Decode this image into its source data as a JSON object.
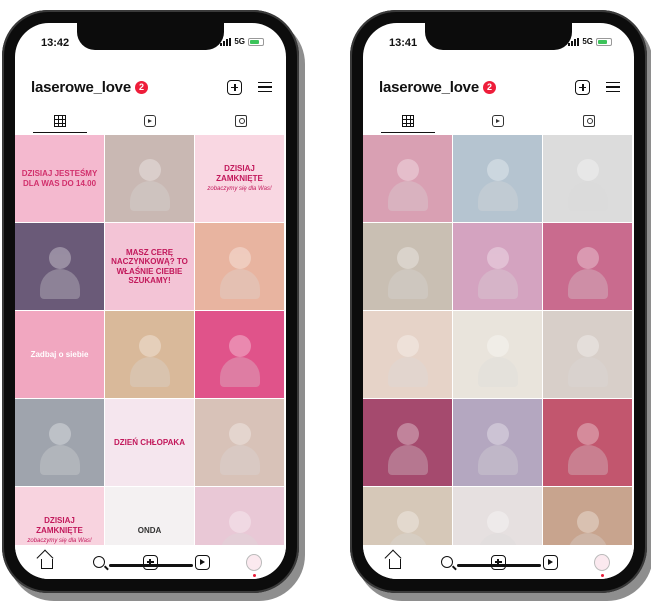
{
  "left_phone": {
    "time": "13:42",
    "network": "5G",
    "username": "laserowe_love",
    "badge": "2",
    "posts": [
      {
        "text": "DZISIAJ JESTEŚMY DLA WAS DO 14.00",
        "sub": "",
        "bg": "#f4b9cf",
        "fg": "#d1306c"
      },
      {
        "text": "",
        "sub": "",
        "bg": "#c9b8b3",
        "fg": "#ffffff"
      },
      {
        "text": "DZISIAJ ZAMKNIĘTE",
        "sub": "zobaczymy się dla Was!",
        "bg": "#f9d7e2",
        "fg": "#c2185b"
      },
      {
        "text": "",
        "sub": "",
        "bg": "#6a5a78",
        "fg": "#ffffff"
      },
      {
        "text": "MASZ CERĘ NACZYNKOWĄ? TO WŁAŚNIE CIEBIE SZUKAMY!",
        "sub": "",
        "bg": "#f3c4d6",
        "fg": "#c2185b"
      },
      {
        "text": "",
        "sub": "",
        "bg": "#e8b4a0",
        "fg": "#ffffff"
      },
      {
        "text": "Zadbaj o siebie",
        "sub": "",
        "bg": "#f1a7c0",
        "fg": "#ffffff"
      },
      {
        "text": "",
        "sub": "",
        "bg": "#d9b99a",
        "fg": "#ffffff"
      },
      {
        "text": "",
        "sub": "",
        "bg": "#e0538a",
        "fg": "#ffffff"
      },
      {
        "text": "",
        "sub": "",
        "bg": "#9fa4ad",
        "fg": "#ffffff"
      },
      {
        "text": "DZIEŃ CHŁOPAKA",
        "sub": "",
        "bg": "#f5e6ee",
        "fg": "#c2185b"
      },
      {
        "text": "",
        "sub": "",
        "bg": "#d8c2b8",
        "fg": "#ffffff"
      },
      {
        "text": "DZISIAJ ZAMKNIĘTE",
        "sub": "zobaczymy się dla Was!",
        "bg": "#f8d3df",
        "fg": "#c2185b"
      },
      {
        "text": "ONDA",
        "sub": "",
        "bg": "#f4f1f2",
        "fg": "#333333"
      },
      {
        "text": "",
        "sub": "",
        "bg": "#e9c8d6",
        "fg": "#ffffff"
      }
    ]
  },
  "right_phone": {
    "time": "13:41",
    "network": "5G",
    "username": "laserowe_love",
    "badge": "2",
    "posts": [
      {
        "text": "",
        "sub": "",
        "bg": "#d9a0b3",
        "fg": "#ffffff"
      },
      {
        "text": "",
        "sub": "",
        "bg": "#b5c4d0",
        "fg": "#ffffff"
      },
      {
        "text": "",
        "sub": "",
        "bg": "#dcdcdc",
        "fg": "#333333"
      },
      {
        "text": "",
        "sub": "",
        "bg": "#c9bfb3",
        "fg": "#ffffff"
      },
      {
        "text": "",
        "sub": "",
        "bg": "#d4a3c0",
        "fg": "#ffffff"
      },
      {
        "text": "",
        "sub": "",
        "bg": "#c96b8e",
        "fg": "#ffffff"
      },
      {
        "text": "",
        "sub": "",
        "bg": "#e6d3c8",
        "fg": "#ffffff"
      },
      {
        "text": "",
        "sub": "",
        "bg": "#e9e4dc",
        "fg": "#ffffff"
      },
      {
        "text": "",
        "sub": "",
        "bg": "#d8cfc9",
        "fg": "#ffffff"
      },
      {
        "text": "",
        "sub": "",
        "bg": "#a54a6e",
        "fg": "#ffffff"
      },
      {
        "text": "",
        "sub": "",
        "bg": "#b4a7c0",
        "fg": "#ffffff"
      },
      {
        "text": "",
        "sub": "",
        "bg": "#c2566e",
        "fg": "#ffffff"
      },
      {
        "text": "",
        "sub": "",
        "bg": "#d6c8b8",
        "fg": "#ffffff"
      },
      {
        "text": "",
        "sub": "",
        "bg": "#e6e0e0",
        "fg": "#ffffff"
      },
      {
        "text": "",
        "sub": "",
        "bg": "#c8a48e",
        "fg": "#ffffff"
      }
    ]
  }
}
